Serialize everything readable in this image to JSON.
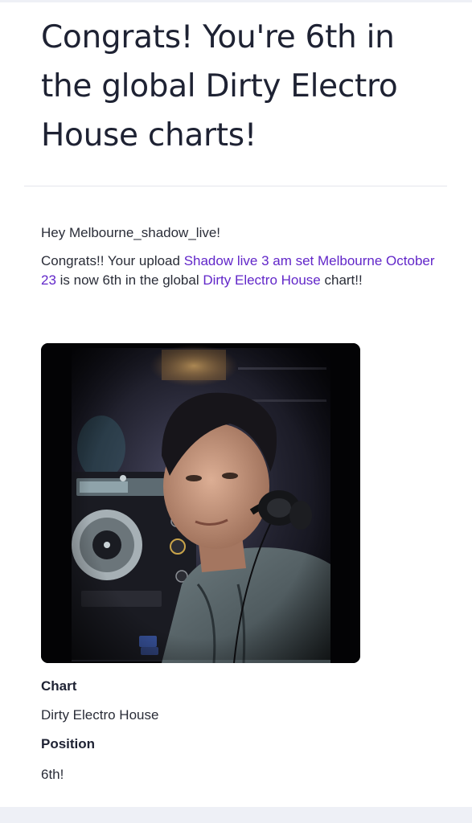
{
  "email": {
    "headline": "Congrats! You're 6th in the global Dirty Electro House charts!",
    "greeting": "Hey Melbourne_shadow_live!",
    "message": {
      "intro": "Congrats!! Your upload ",
      "upload_link": "Shadow live 3 am set Melbourne October 23",
      "middle": " is now 6th in the global ",
      "chart_link": "Dirty Electro House",
      "outro": " chart!!"
    },
    "photo_description": "DJ with headphones beside turntable",
    "fields": {
      "chart_label": "Chart",
      "chart_value": "Dirty Electro House",
      "position_label": "Position",
      "position_value": "6th!"
    }
  },
  "colors": {
    "link": "#6227c9",
    "headline": "#1e2233",
    "body_text": "#2a2d38",
    "page_background": "#eef0f6"
  }
}
